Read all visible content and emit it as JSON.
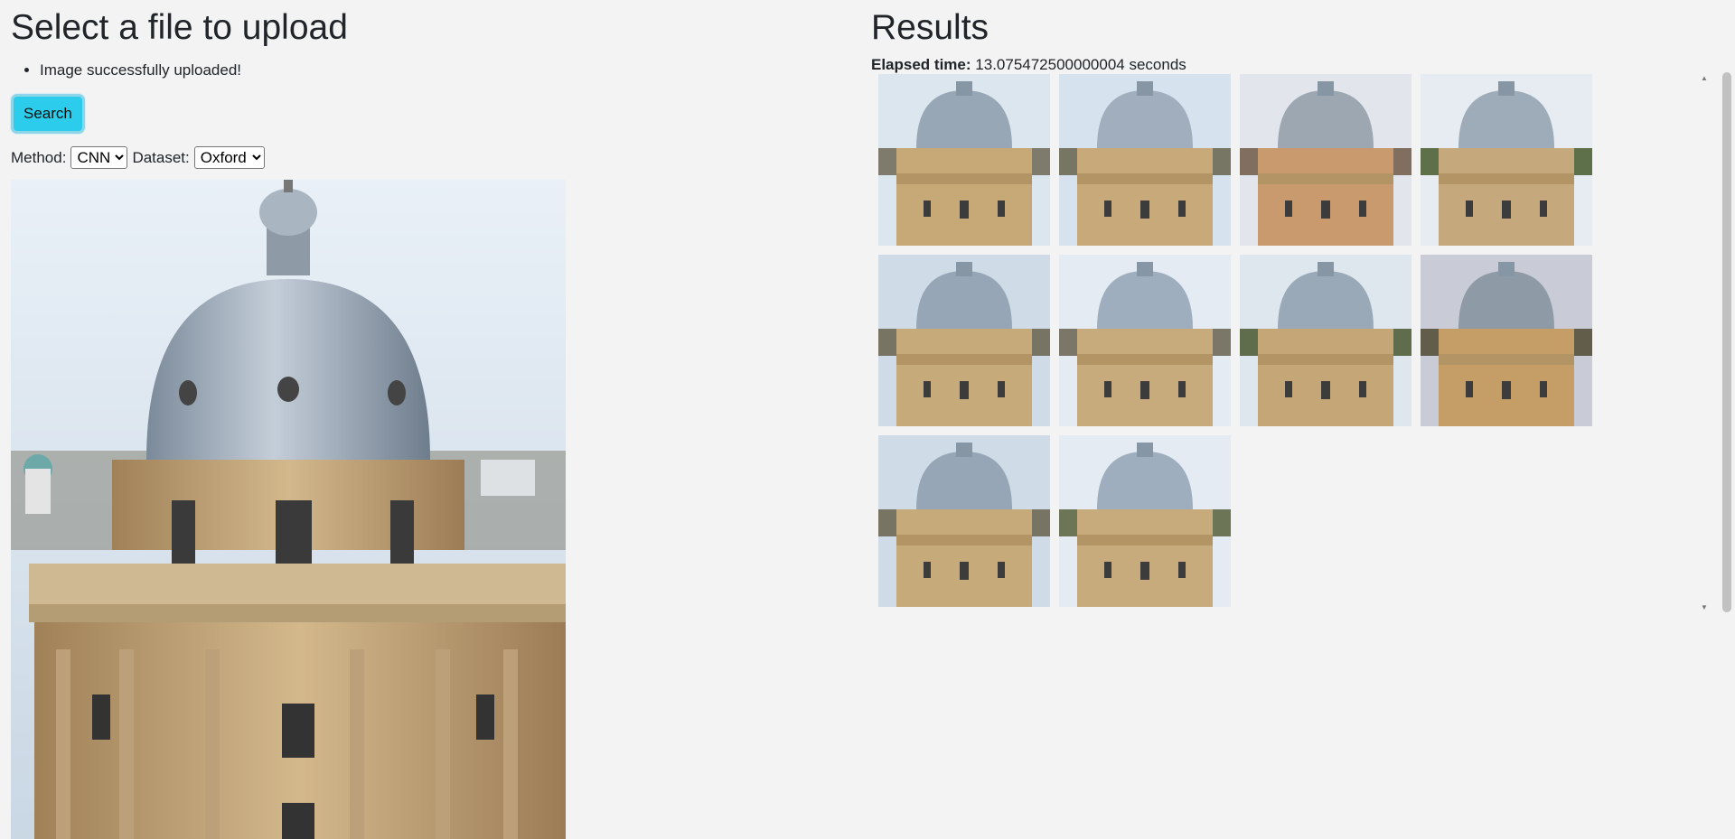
{
  "upload": {
    "title": "Select a file to upload",
    "status_items": [
      "Image successfully uploaded!"
    ],
    "search_label": "Search",
    "method_label": "Method:",
    "method_value": "CNN",
    "dataset_label": "Dataset:",
    "dataset_value": "Oxford"
  },
  "results": {
    "title": "Results",
    "elapsed_label": "Elapsed time:",
    "elapsed_value": "13.075472500000004 seconds",
    "thumbnails": [
      "dome-photo-1",
      "dome-photo-2",
      "dome-photo-3",
      "dome-photo-4",
      "dome-photo-5",
      "dome-photo-6",
      "dome-photo-7",
      "dome-photo-8",
      "dome-photo-9",
      "dome-photo-10"
    ]
  },
  "colors": {
    "background": "#f3f3f3",
    "button": "#2ccdec",
    "sky": "#dbe6ef",
    "stone": "#c7a978",
    "dome": "#9aa9b8"
  }
}
